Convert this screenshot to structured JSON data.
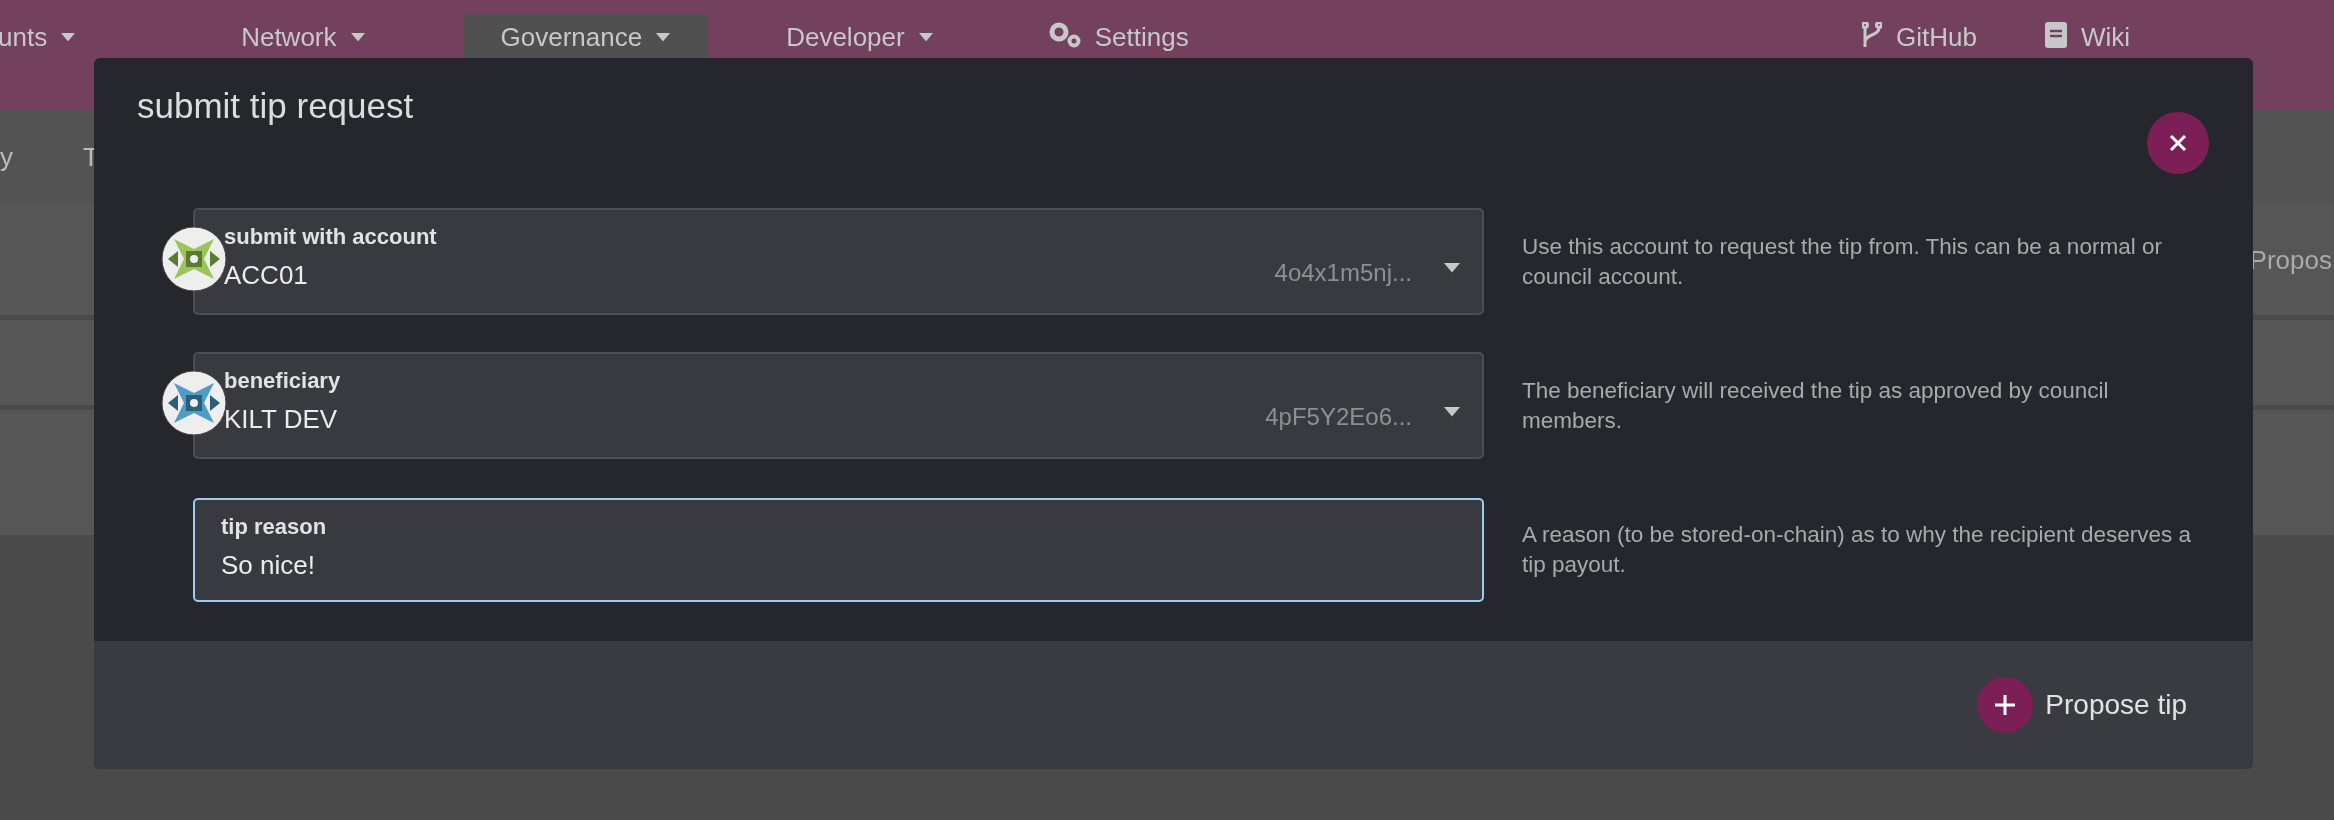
{
  "nav": {
    "items": [
      {
        "label": "unts",
        "caret": true,
        "selected": false
      },
      {
        "label": "Network",
        "caret": true,
        "selected": false
      },
      {
        "label": "Governance",
        "caret": true,
        "selected": true
      },
      {
        "label": "Developer",
        "caret": true,
        "selected": false
      },
      {
        "label": "Settings",
        "caret": false,
        "selected": false
      }
    ],
    "links": [
      {
        "label": "GitHub"
      },
      {
        "label": "Wiki"
      }
    ]
  },
  "subnav": {
    "items": [
      "y",
      "T"
    ]
  },
  "background_text": "Propos",
  "modal": {
    "title": "submit tip request",
    "fields": [
      {
        "kind": "account",
        "label": "submit with account",
        "value": "ACC01",
        "address": "4o4x1m5nj...",
        "help": "Use this account to request the tip from. This can be a normal or council account.",
        "focused": false
      },
      {
        "kind": "account",
        "label": "beneficiary",
        "value": "KILT DEV",
        "address": "4pF5Y2Eo6...",
        "help": "The beneficiary will received the tip as approved by council members.",
        "focused": false
      },
      {
        "kind": "text",
        "label": "tip reason",
        "value": "So nice!",
        "help": "A reason (to be stored-on-chain) as to why the recipient deserves a tip payout.",
        "focused": true
      }
    ],
    "submit": {
      "label": "Propose tip"
    }
  }
}
